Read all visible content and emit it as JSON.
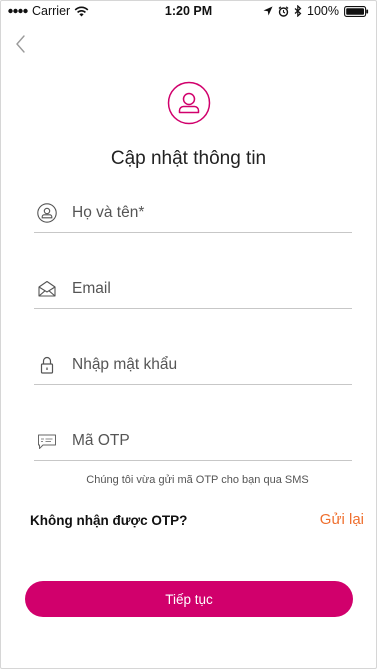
{
  "status_bar": {
    "carrier": "Carrier",
    "time": "1:20 PM",
    "battery": "100%"
  },
  "icons": {
    "back": "chevron-left-icon",
    "header": "user-circle-icon",
    "name": "user-icon",
    "email": "envelope-icon",
    "password": "lock-icon",
    "otp": "sms-icon"
  },
  "colors": {
    "accent": "#d1006c",
    "link": "#ef6f2e"
  },
  "header": {
    "title": "Cập nhật thông tin"
  },
  "form": {
    "name_placeholder": "Họ và tên*",
    "email_placeholder": "Email",
    "password_placeholder": "Nhập mật khẩu",
    "otp_placeholder": "Mã OTP",
    "otp_note": "Chúng tôi vừa gửi mã OTP cho bạn qua SMS"
  },
  "resend": {
    "question": "Không nhận được OTP?",
    "link": "Gửi lại"
  },
  "continue_button": "Tiếp tục"
}
